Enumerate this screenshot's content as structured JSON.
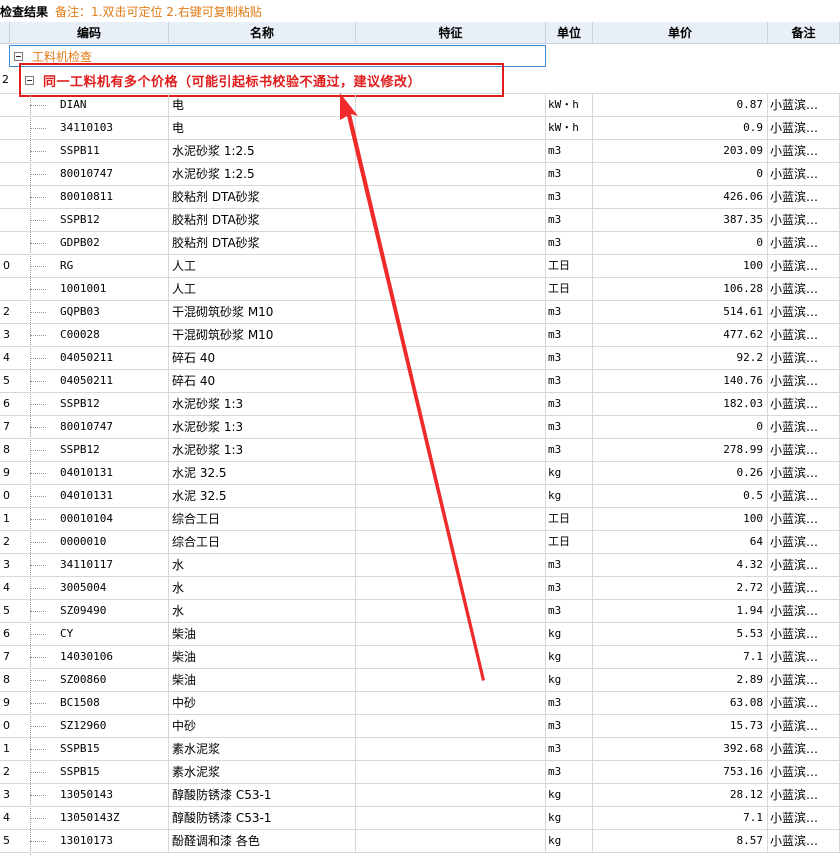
{
  "titlebar": {
    "title": "检查结果",
    "note": "备注：1.双击可定位 2.右键可复制粘贴"
  },
  "columns": {
    "code": "编码",
    "name": "名称",
    "feature": "特征",
    "unit": "单位",
    "price": "单价",
    "remark": "备注"
  },
  "group": {
    "label": "工料机检查"
  },
  "warning": {
    "label": "同一工料机有多个价格（可能引起标书校验不通过，建议修改）"
  },
  "rows": [
    {
      "n": "",
      "code": "DIAN",
      "name": "电",
      "unit": "kW・h",
      "price": "0.87",
      "remark": "小蓝滨…"
    },
    {
      "n": "",
      "code": "34110103",
      "name": "电",
      "unit": "kW・h",
      "price": "0.9",
      "remark": "小蓝滨…"
    },
    {
      "n": "",
      "code": "SSPB11",
      "name": "水泥砂浆 1:2.5",
      "unit": "m3",
      "price": "203.09",
      "remark": "小蓝滨…"
    },
    {
      "n": "",
      "code": "80010747",
      "name": "水泥砂浆 1:2.5",
      "unit": "m3",
      "price": "0",
      "remark": "小蓝滨…"
    },
    {
      "n": "",
      "code": "80010811",
      "name": "胶粘剂 DTA砂浆",
      "unit": "m3",
      "price": "426.06",
      "remark": "小蓝滨…"
    },
    {
      "n": "",
      "code": "SSPB12",
      "name": "胶粘剂 DTA砂浆",
      "unit": "m3",
      "price": "387.35",
      "remark": "小蓝滨…"
    },
    {
      "n": "",
      "code": "GDPB02",
      "name": "胶粘剂 DTA砂浆",
      "unit": "m3",
      "price": "0",
      "remark": "小蓝滨…"
    },
    {
      "n": "0",
      "code": "RG",
      "name": "人工",
      "unit": "工日",
      "price": "100",
      "remark": "小蓝滨…"
    },
    {
      "n": "",
      "code": "1001001",
      "name": "人工",
      "unit": "工日",
      "price": "106.28",
      "remark": "小蓝滨…"
    },
    {
      "n": "2",
      "code": "GQPB03",
      "name": "干混砌筑砂浆 M10",
      "unit": "m3",
      "price": "514.61",
      "remark": "小蓝滨…"
    },
    {
      "n": "3",
      "code": "C00028",
      "name": "干混砌筑砂浆 M10",
      "unit": "m3",
      "price": "477.62",
      "remark": "小蓝滨…"
    },
    {
      "n": "4",
      "code": "04050211",
      "name": "碎石 40",
      "unit": "m3",
      "price": "92.2",
      "remark": "小蓝滨…"
    },
    {
      "n": "5",
      "code": "04050211",
      "name": "碎石 40",
      "unit": "m3",
      "price": "140.76",
      "remark": "小蓝滨…"
    },
    {
      "n": "6",
      "code": "SSPB12",
      "name": "水泥砂浆 1:3",
      "unit": "m3",
      "price": "182.03",
      "remark": "小蓝滨…"
    },
    {
      "n": "7",
      "code": "80010747",
      "name": "水泥砂浆 1:3",
      "unit": "m3",
      "price": "0",
      "remark": "小蓝滨…"
    },
    {
      "n": "8",
      "code": "SSPB12",
      "name": "水泥砂浆 1:3",
      "unit": "m3",
      "price": "278.99",
      "remark": "小蓝滨…"
    },
    {
      "n": "9",
      "code": "04010131",
      "name": "水泥 32.5",
      "unit": "kg",
      "price": "0.26",
      "remark": "小蓝滨…"
    },
    {
      "n": "0",
      "code": "04010131",
      "name": "水泥 32.5",
      "unit": "kg",
      "price": "0.5",
      "remark": "小蓝滨…"
    },
    {
      "n": "1",
      "code": "00010104",
      "name": "综合工日",
      "unit": "工日",
      "price": "100",
      "remark": "小蓝滨…"
    },
    {
      "n": "2",
      "code": "0000010",
      "name": "综合工日",
      "unit": "工日",
      "price": "64",
      "remark": "小蓝滨…"
    },
    {
      "n": "3",
      "code": "34110117",
      "name": "水",
      "unit": "m3",
      "price": "4.32",
      "remark": "小蓝滨…"
    },
    {
      "n": "4",
      "code": "3005004",
      "name": "水",
      "unit": "m3",
      "price": "2.72",
      "remark": "小蓝滨…"
    },
    {
      "n": "5",
      "code": "SZ09490",
      "name": "水",
      "unit": "m3",
      "price": "1.94",
      "remark": "小蓝滨…"
    },
    {
      "n": "6",
      "code": "CY",
      "name": "柴油",
      "unit": "kg",
      "price": "5.53",
      "remark": "小蓝滨…"
    },
    {
      "n": "7",
      "code": "14030106",
      "name": "柴油",
      "unit": "kg",
      "price": "7.1",
      "remark": "小蓝滨…"
    },
    {
      "n": "8",
      "code": "SZ00860",
      "name": "柴油",
      "unit": "kg",
      "price": "2.89",
      "remark": "小蓝滨…"
    },
    {
      "n": "9",
      "code": "BC1508",
      "name": "中砂",
      "unit": "m3",
      "price": "63.08",
      "remark": "小蓝滨…"
    },
    {
      "n": "0",
      "code": "SZ12960",
      "name": "中砂",
      "unit": "m3",
      "price": "15.73",
      "remark": "小蓝滨…"
    },
    {
      "n": "1",
      "code": "SSPB15",
      "name": "素水泥浆",
      "unit": "m3",
      "price": "392.68",
      "remark": "小蓝滨…"
    },
    {
      "n": "2",
      "code": "SSPB15",
      "name": "素水泥浆",
      "unit": "m3",
      "price": "753.16",
      "remark": "小蓝滨…"
    },
    {
      "n": "3",
      "code": "13050143",
      "name": "醇酸防锈漆 C53-1",
      "unit": "kg",
      "price": "28.12",
      "remark": "小蓝滨…"
    },
    {
      "n": "4",
      "code": "13050143Z",
      "name": "醇酸防锈漆 C53-1",
      "unit": "kg",
      "price": "7.1",
      "remark": "小蓝滨…"
    },
    {
      "n": "5",
      "code": "13010173",
      "name": "酚醛调和漆 各色",
      "unit": "kg",
      "price": "8.57",
      "remark": "小蓝滨…"
    }
  ],
  "colors": {
    "header_bg": "#e9eff7",
    "accent_orange": "#e07a12",
    "warning_red": "#e01b1b",
    "selection_blue": "#3b8ddb"
  }
}
